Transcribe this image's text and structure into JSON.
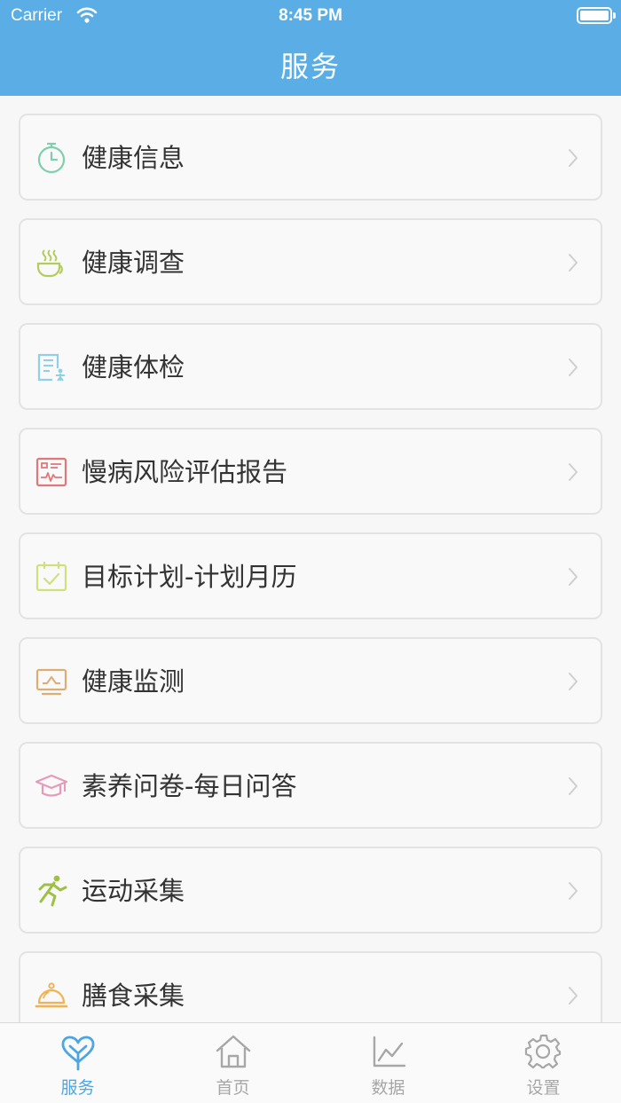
{
  "status_bar": {
    "carrier": "Carrier",
    "time": "8:45 PM"
  },
  "header": {
    "title": "服务"
  },
  "colors": {
    "header_bg": "#5aaee5",
    "active_tab": "#4da6e3",
    "inactive_tab": "#a7a7a7"
  },
  "menu": {
    "items": [
      {
        "label": "健康信息",
        "icon": "stopwatch-icon"
      },
      {
        "label": "健康调查",
        "icon": "coffee-cup-icon"
      },
      {
        "label": "健康体检",
        "icon": "checkup-document-icon"
      },
      {
        "label": "慢病风险评估报告",
        "icon": "heart-monitor-report-icon"
      },
      {
        "label": "目标计划-计划月历",
        "icon": "calendar-check-icon"
      },
      {
        "label": "健康监测",
        "icon": "monitor-screen-icon"
      },
      {
        "label": "素养问卷-每日问答",
        "icon": "graduation-cap-icon"
      },
      {
        "label": "运动采集",
        "icon": "running-person-icon"
      },
      {
        "label": "膳食采集",
        "icon": "food-cloche-icon"
      }
    ]
  },
  "tabbar": {
    "tabs": [
      {
        "label": "服务",
        "icon": "heart-service-icon",
        "active": true
      },
      {
        "label": "首页",
        "icon": "home-icon",
        "active": false
      },
      {
        "label": "数据",
        "icon": "line-chart-icon",
        "active": false
      },
      {
        "label": "设置",
        "icon": "gear-icon",
        "active": false
      }
    ]
  }
}
